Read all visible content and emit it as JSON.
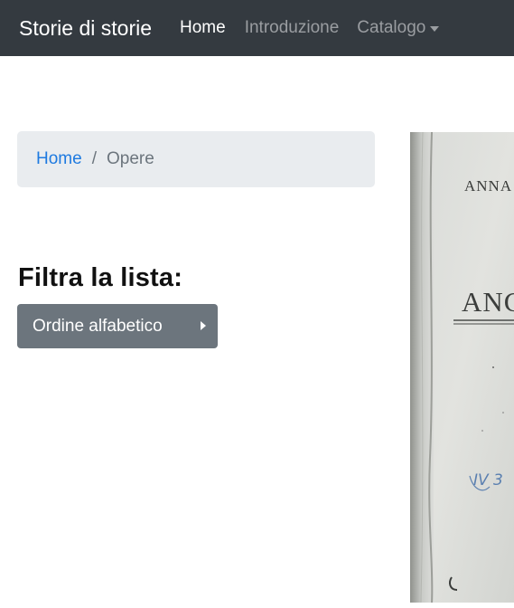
{
  "navbar": {
    "brand": "Storie di storie",
    "items": [
      {
        "label": "Home",
        "active": true
      },
      {
        "label": "Introduzione",
        "active": false
      },
      {
        "label": "Catalogo",
        "active": false,
        "dropdown": true
      }
    ]
  },
  "breadcrumb": {
    "items": [
      {
        "label": "Home",
        "link": true
      },
      {
        "label": "Opere",
        "link": false
      }
    ],
    "separator": "/"
  },
  "filter": {
    "title": "Filtra la lista:",
    "button_label": "Ordine alfabetico"
  },
  "book_cover": {
    "author_text": "ANNA",
    "title_text": "ANG",
    "handwritten_note": "IV 3"
  },
  "colors": {
    "navbar_bg": "#343a40",
    "breadcrumb_bg": "#e9ecef",
    "link": "#1e7ae0",
    "button_bg": "#6c757d"
  }
}
